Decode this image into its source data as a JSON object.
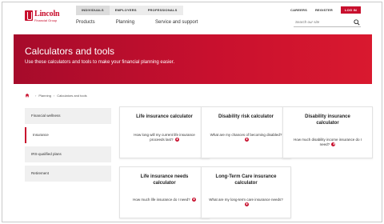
{
  "brand": {
    "name": "Lincoln",
    "subtitle": "Financial Group",
    "accent": "#c8102e"
  },
  "audience_tabs": [
    "INDIVIDUALS",
    "EMPLOYERS",
    "PROFESSIONALS"
  ],
  "utility_links": {
    "careers": "CAREERS",
    "register": "REGISTER",
    "login": "LOG IN"
  },
  "main_nav": [
    "Products",
    "Planning",
    "Service and support"
  ],
  "search": {
    "placeholder": "Search our site",
    "icon": "search-icon"
  },
  "hero": {
    "title": "Calculators and tools",
    "subtitle": "Use these calculators and tools to make your financial planning easier."
  },
  "breadcrumb": {
    "home_icon": "home-icon",
    "items": [
      "Planning",
      "Calculators and tools"
    ]
  },
  "sidebar": {
    "items": [
      {
        "label": "Financial wellness"
      },
      {
        "label": "Insurance"
      },
      {
        "label": "IRS-qualified plans"
      },
      {
        "label": "Retirement"
      }
    ]
  },
  "cards": [
    {
      "title": "Life insurance calculator",
      "question": "How long will my current life insurance proceeds last?"
    },
    {
      "title": "Disability risk calculator",
      "question": "What are my chances of becoming disabled?"
    },
    {
      "title": "Disability insurance calculator",
      "question": "How much disability income insurance do I need?"
    },
    {
      "title": "Life insurance needs calculator",
      "question": "How much life insurance do I need?"
    },
    {
      "title": "Long-Term Care insurance calculator",
      "question": "What are my long-term care insurance needs?"
    }
  ]
}
